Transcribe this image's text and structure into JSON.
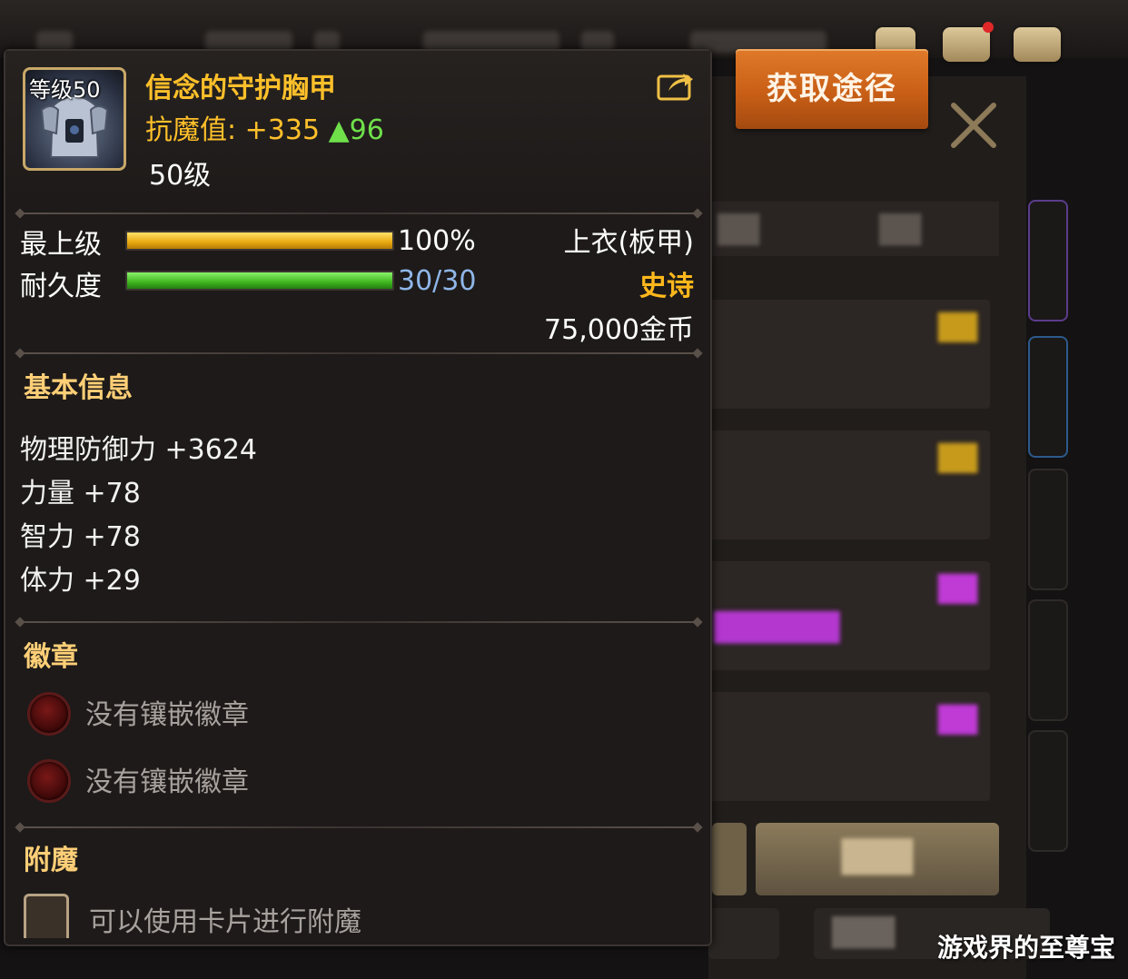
{
  "tooltip": {
    "level_badge": "等级50",
    "item_name": "信念的守护胸甲",
    "resist_label": "抗魔值: +335",
    "resist_increase": "▲96",
    "required_level": "50级",
    "grade_label": "最上级",
    "grade_value": "100%",
    "grade_fraction": 1.0,
    "durability_label": "耐久度",
    "durability_value": "30/30",
    "durability_fraction": 1.0,
    "item_type": "上衣(板甲)",
    "rarity": "史诗",
    "price": "75,000金币",
    "basic_info_title": "基本信息",
    "attributes": [
      "物理防御力 +3624",
      "力量 +78",
      "智力 +78",
      "体力 +29"
    ],
    "emblem_title": "徽章",
    "emblem_slots": [
      "没有镶嵌徽章",
      "没有镶嵌徽章"
    ],
    "enchant_title": "附魔",
    "enchant_text": "可以使用卡片进行附魔"
  },
  "get_source_label": "获取途径",
  "watermark": "游戏界的至尊宝",
  "colors": {
    "item_name": "#ffc02a",
    "rarity_epic": "#ffb81c",
    "increase_green": "#6fe04a",
    "section_title": "#ffcf77",
    "durability_value": "#8fb6e8",
    "button_orange": "#c95f16"
  },
  "icons": {
    "share": "share-icon",
    "close": "close-icon",
    "emblem_slot": "emblem-slot-icon",
    "card_slot": "card-slot-icon"
  }
}
